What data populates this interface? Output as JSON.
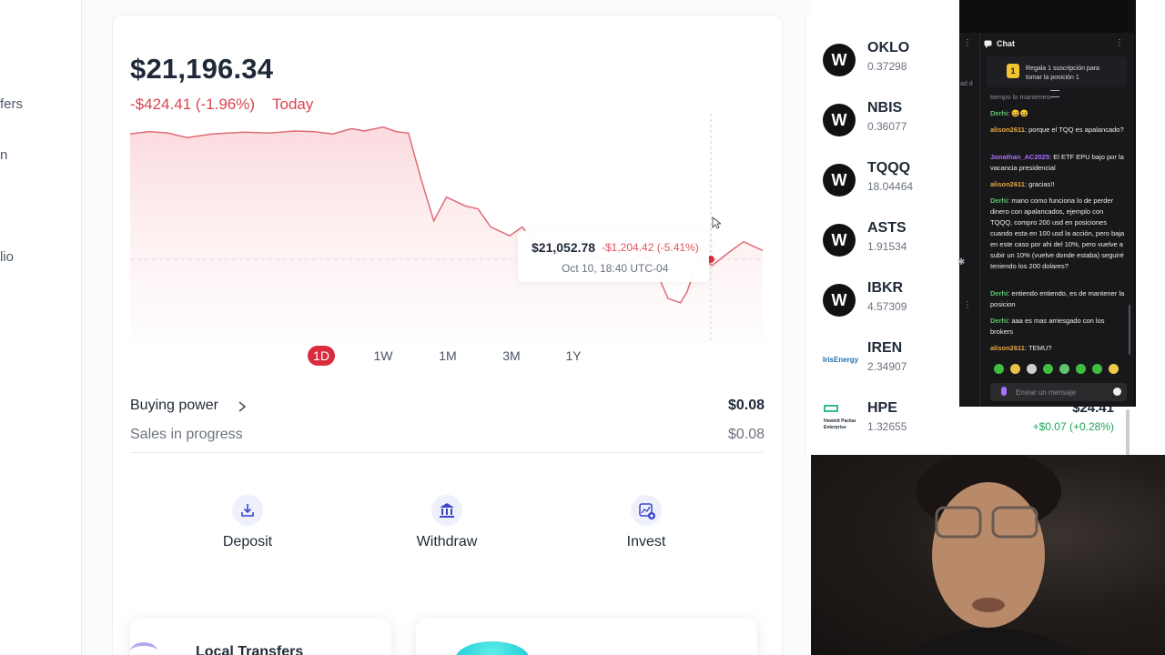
{
  "sidebar": {
    "items": [
      {
        "label": "fers"
      },
      {
        "label": "n"
      },
      {
        "label": "lio"
      }
    ]
  },
  "portfolio": {
    "balance": "$21,196.34",
    "change": "-$424.41 (-1.96%)",
    "period": "Today"
  },
  "chart_data": {
    "type": "area",
    "title": "",
    "xlabel": "",
    "ylabel": "",
    "ylim": [
      20750,
      21520
    ],
    "x": [
      0,
      0.03,
      0.06,
      0.09,
      0.13,
      0.18,
      0.22,
      0.26,
      0.29,
      0.32,
      0.35,
      0.37,
      0.4,
      0.42,
      0.44,
      0.46,
      0.48,
      0.5,
      0.53,
      0.55,
      0.57,
      0.6,
      0.62,
      0.65,
      0.68,
      0.72,
      0.76,
      0.79,
      0.81,
      0.83,
      0.85,
      0.87,
      0.88,
      0.9,
      0.92,
      0.95,
      0.97,
      1.0
    ],
    "values": [
      21452,
      21460,
      21455,
      21440,
      21452,
      21458,
      21455,
      21462,
      21460,
      21452,
      21470,
      21462,
      21475,
      21460,
      21455,
      21300,
      21160,
      21240,
      21210,
      21200,
      21140,
      21110,
      21140,
      21052,
      21050,
      21045,
      21030,
      21020,
      21060,
      21000,
      20900,
      20885,
      20920,
      21040,
      21010,
      21060,
      21090,
      21060
    ],
    "baseline": 21031,
    "series": [
      {
        "values": [
          21452,
          21460,
          21455,
          21440,
          21452,
          21458,
          21455,
          21462,
          21460,
          21452,
          21470,
          21462,
          21475,
          21460,
          21455,
          21300,
          21160,
          21240,
          21210,
          21200,
          21140,
          21110,
          21140,
          21052,
          21050,
          21045,
          21030,
          21020,
          21060,
          21000,
          20900,
          20885,
          20920,
          21040,
          21010,
          21060,
          21090,
          21060
        ]
      }
    ],
    "tooltip": {
      "value": "$21,052.78",
      "change": "-$1,204.42 (-5.41%)",
      "date": "Oct 10, 18:40 UTC-04"
    },
    "colors": {
      "line": "#e06c75",
      "fill": "#fde8ea",
      "marker": "#e0303f"
    }
  },
  "ranges": [
    "1D",
    "1W",
    "1M",
    "3M",
    "1Y"
  ],
  "active_range": "1D",
  "buying_power": {
    "label": "Buying power",
    "value": "$0.08"
  },
  "sales_in_progress": {
    "label": "Sales in progress",
    "value": "$0.08"
  },
  "actions": {
    "deposit": "Deposit",
    "withdraw": "Withdraw",
    "invest": "Invest"
  },
  "bottom_cards": {
    "local_transfers": "Local Transfers"
  },
  "watchlist": [
    {
      "symbol": "OKLO",
      "sub": "0.37298",
      "logo": "W"
    },
    {
      "symbol": "NBIS",
      "sub": "0.36077",
      "logo": "W"
    },
    {
      "symbol": "TQQQ",
      "sub": "18.04464",
      "logo": "W"
    },
    {
      "symbol": "ASTS",
      "sub": "1.91534",
      "logo": "W"
    },
    {
      "symbol": "IBKR",
      "sub": "4.57309",
      "logo": "W"
    },
    {
      "symbol": "IREN",
      "sub": "2.34907",
      "logo": "IrisEnergy"
    },
    {
      "symbol": "HPE",
      "sub": "1.32655",
      "logo": "Hewlett Packard Enterprise",
      "price": "$24.41",
      "change": "+$0.07 (+0.28%)"
    }
  ],
  "chat": {
    "title": "Chat",
    "sub_banner": "Regala 1 suscripción para tomar la posición 1",
    "sub_badge": "1",
    "side_fragment": "ad d",
    "messages": [
      {
        "user": "",
        "text": "tiempo lo mantenes.",
        "color": "#efeff1"
      },
      {
        "user": "Derhi",
        "text": "😀😀",
        "color": "#5ec46d"
      },
      {
        "user": "alison2611",
        "text": "porque el TQQ es apalancado?",
        "color": "#e8a83e"
      },
      {
        "user": "Jonathan_AC2025",
        "text": "El ETF EPU bajo por la vacancia presidencial",
        "color": "#a970ff"
      },
      {
        "user": "alison2611",
        "text": "gracias!!",
        "color": "#e8a83e"
      },
      {
        "user": "Derhi",
        "text": "mano como funciona lo de perder dinero con apalancados, ejemplo con TQQQ, compro 200 usd en posiciones cuando esta en 100 usd la acción, pero baja en este caso por ahi del 10%, pero vuelve a subir un 10% (vuelve donde estaba) seguiré teniendo los 200 dolares?",
        "color": "#5ec46d"
      },
      {
        "user": "Derhi",
        "text": "entiendo entiendo, es de mantener la posicion",
        "color": "#5ec46d"
      },
      {
        "user": "Derhi",
        "text": "aaa es mas arriesgado con los brokers",
        "color": "#5ec46d"
      },
      {
        "user": "alison2611",
        "text": "TEMU?",
        "color": "#e8a83e"
      }
    ],
    "input_placeholder": "Enviar un mensaje"
  }
}
